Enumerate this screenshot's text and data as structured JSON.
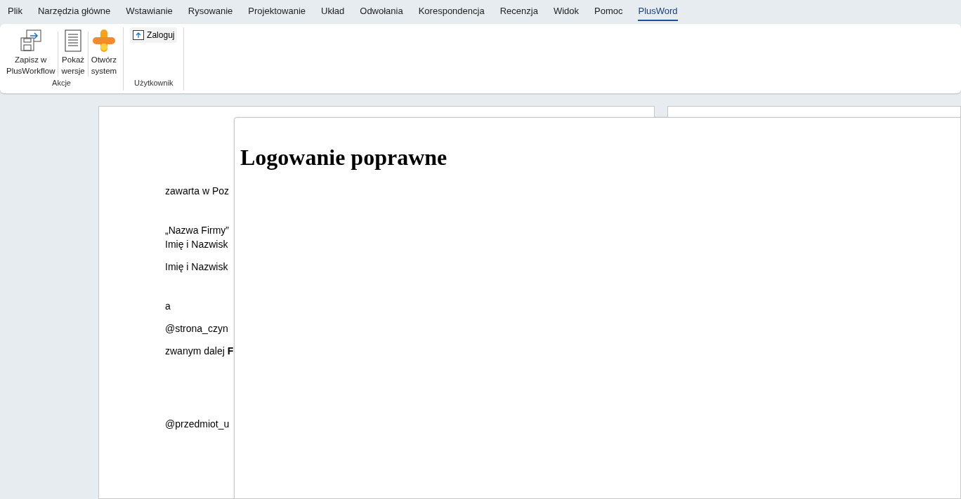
{
  "tabs": [
    {
      "label": "Plik",
      "selected": false
    },
    {
      "label": "Narzędzia główne",
      "selected": false
    },
    {
      "label": "Wstawianie",
      "selected": false
    },
    {
      "label": "Rysowanie",
      "selected": false
    },
    {
      "label": "Projektowanie",
      "selected": false
    },
    {
      "label": "Układ",
      "selected": false
    },
    {
      "label": "Odwołania",
      "selected": false
    },
    {
      "label": "Korespondencja",
      "selected": false
    },
    {
      "label": "Recenzja",
      "selected": false
    },
    {
      "label": "Widok",
      "selected": false
    },
    {
      "label": "Pomoc",
      "selected": false
    },
    {
      "label": "PlusWord",
      "selected": true
    }
  ],
  "ribbon_groups": [
    {
      "label": "Akcje",
      "buttons": [
        {
          "kind": "save",
          "label_lines": [
            "Zapisz w",
            "PlusWorkflow"
          ]
        },
        {
          "kind": "versions",
          "label_lines": [
            "Pokaż",
            "wersje"
          ]
        },
        {
          "kind": "open",
          "label_lines": [
            "Otwórz",
            "system"
          ]
        }
      ]
    },
    {
      "label": "Użytkownik",
      "buttons": [
        {
          "kind": "login",
          "label_lines": [
            "Zaloguj"
          ]
        }
      ]
    }
  ],
  "document_lines": [
    {
      "text": "zawarta w Poz"
    },
    {
      "text": "„Nazwa Firmy”"
    },
    {
      "text": "Imię i Nazwisk"
    },
    {
      "text": "Imię i Nazwisk"
    },
    {
      "text": "a"
    },
    {
      "text": "@strona_czyn"
    },
    {
      "text": "zwanym dalej **F**"
    },
    {
      "text": "@przedmiot_u"
    }
  ],
  "dialog": {
    "heading": "Logowanie poprawne"
  }
}
